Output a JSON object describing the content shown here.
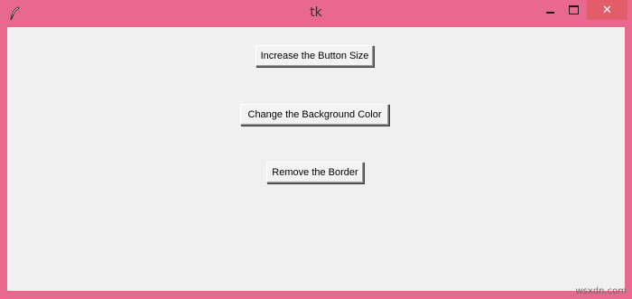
{
  "window": {
    "title": "tk",
    "app_icon": "feather-icon",
    "frame_color": "#e9688f",
    "controls": {
      "minimize_icon": "minimize-icon",
      "maximize_icon": "maximize-icon",
      "close_icon": "close-icon",
      "close_glyph": "✕"
    }
  },
  "buttons": [
    {
      "label": "Increase the Button Size"
    },
    {
      "label": "Change the Background Color"
    },
    {
      "label": "Remove the Border"
    }
  ],
  "watermark": "wsxdn.com"
}
